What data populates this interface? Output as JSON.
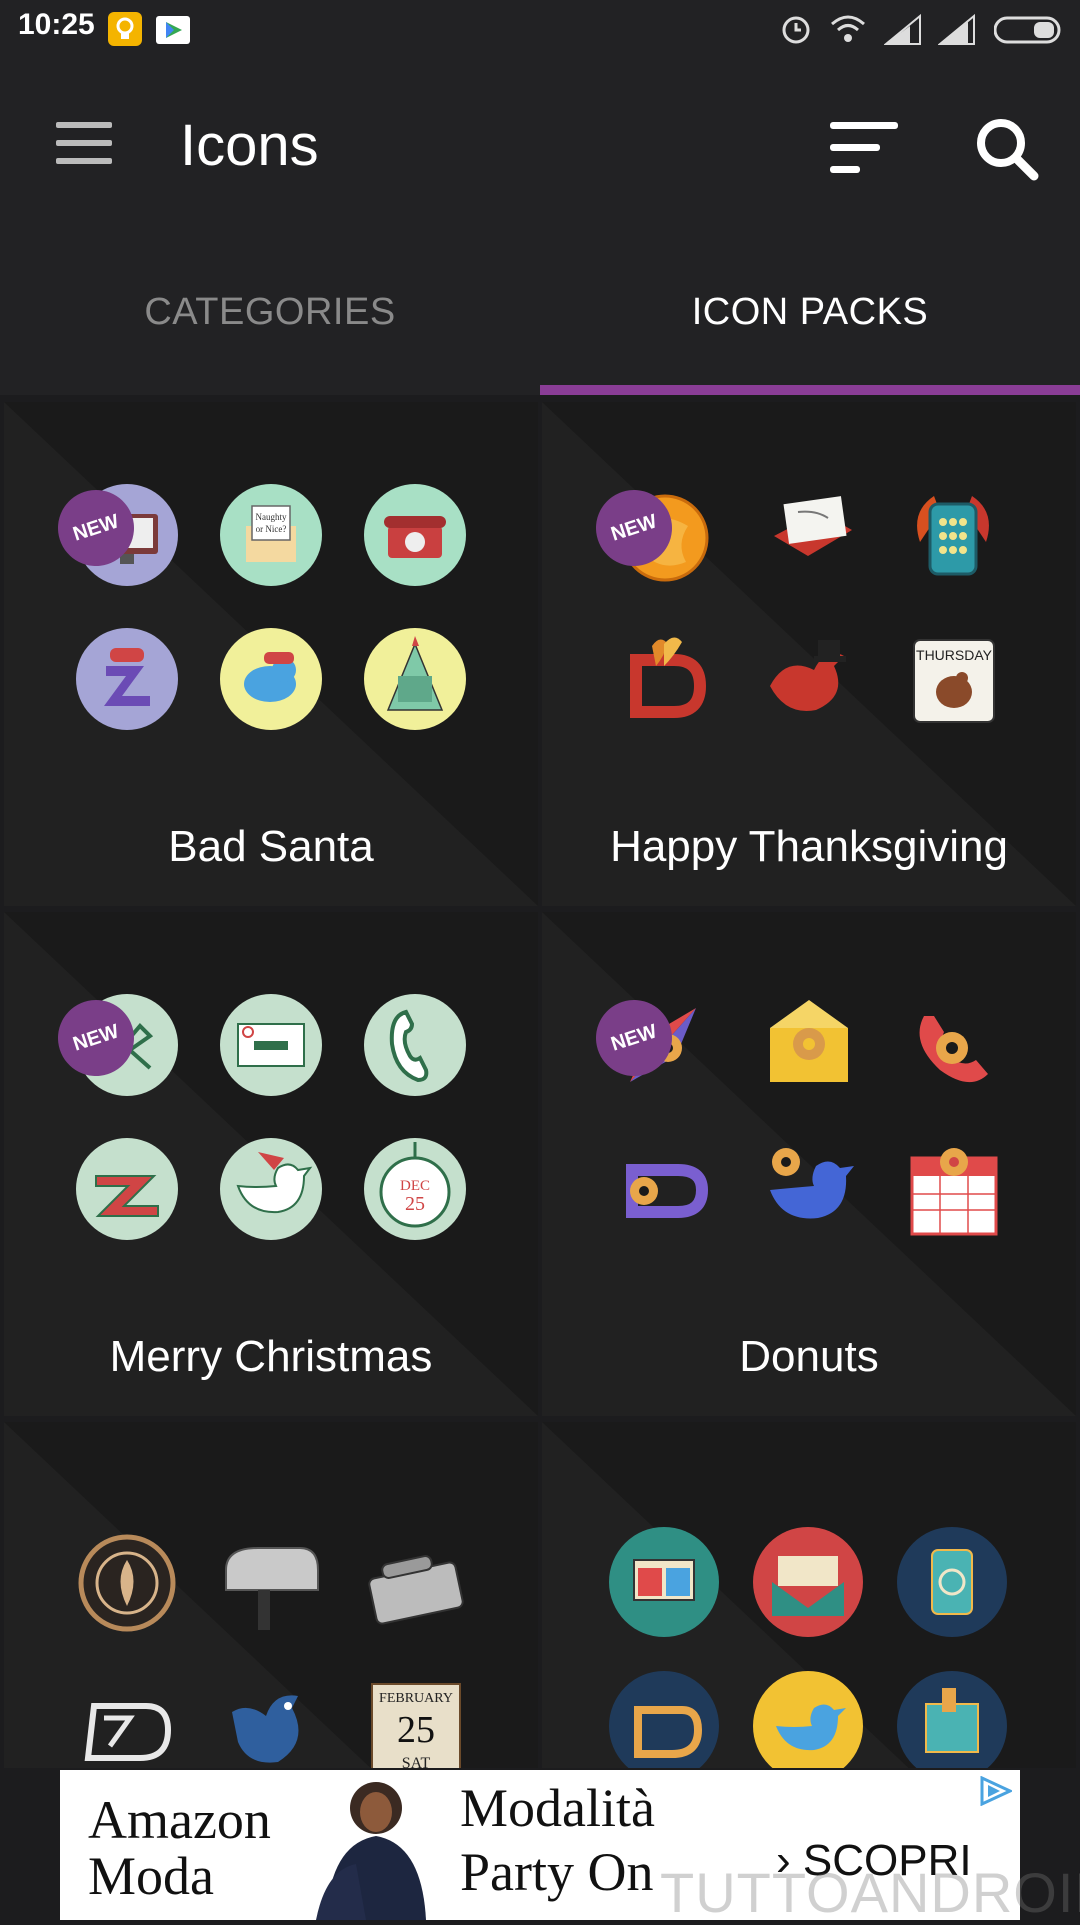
{
  "status_bar": {
    "time": "10:25",
    "left_icons": [
      "bulb-icon",
      "play-store-icon"
    ],
    "right_icons": [
      "alarm-icon",
      "wifi-icon",
      "signal-icon",
      "signal-icon",
      "battery-icon"
    ]
  },
  "toolbar": {
    "title": "Icons",
    "menu_icon": "hamburger-menu-icon",
    "sort_icon": "sort-icon",
    "search_icon": "search-icon"
  },
  "tabs": [
    {
      "label": "CATEGORIES",
      "selected": false
    },
    {
      "label": "ICON PACKS",
      "selected": true
    }
  ],
  "colors": {
    "background": "#1c1c1e",
    "toolbar": "#222224",
    "accent": "#8a3d96",
    "badge": "#7a3e88",
    "tab_inactive": "#8a8a8a"
  },
  "icon_packs": [
    {
      "name": "Bad Santa",
      "badge": "NEW",
      "icons": [
        "monitor-icon",
        "letter-icon",
        "telephone-icon",
        "zedge-icon",
        "twitter-bird-icon",
        "calendar-tree-icon"
      ]
    },
    {
      "name": "Happy Thanksgiving",
      "badge": "NEW",
      "icons": [
        "globe-icon",
        "mail-icon",
        "dialer-icon",
        "zedge-icon",
        "bird-icon",
        "calendar-icon"
      ]
    },
    {
      "name": "Merry Christmas",
      "badge": "NEW",
      "icons": [
        "compass-icon",
        "envelope-icon",
        "phone-icon",
        "zedge-icon",
        "twitter-bird-icon",
        "calendar-icon"
      ]
    },
    {
      "name": "Donuts",
      "badge": "NEW",
      "icons": [
        "compass-icon",
        "mail-icon",
        "phone-icon",
        "zedge-icon",
        "twitter-bird-icon",
        "calendar-icon"
      ]
    },
    {
      "name": "",
      "badge": "",
      "icons": [
        "emblem-icon",
        "mailbox-icon",
        "telephone-icon",
        "zedge-icon",
        "bird-icon",
        "calendar-icon"
      ]
    },
    {
      "name": "",
      "badge": "",
      "icons": [
        "browser-icon",
        "mail-icon",
        "dialer-icon",
        "zedge-icon",
        "twitter-bird-icon",
        "calendar-icon"
      ]
    }
  ],
  "icon_text": {
    "naughty_nice": "Naughty or Nice?",
    "thursday": "THURSDAY",
    "dec25": "DEC 25",
    "feb_month": "FEBRUARY",
    "feb_day": "25",
    "feb_weekday": "SAT"
  },
  "ad": {
    "brand": "Amazon Moda",
    "headline": "Modalità Party On",
    "cta": "› SCOPRI",
    "choice_icon": "ad-choices-icon"
  },
  "watermark": "TUTTOANDROID"
}
